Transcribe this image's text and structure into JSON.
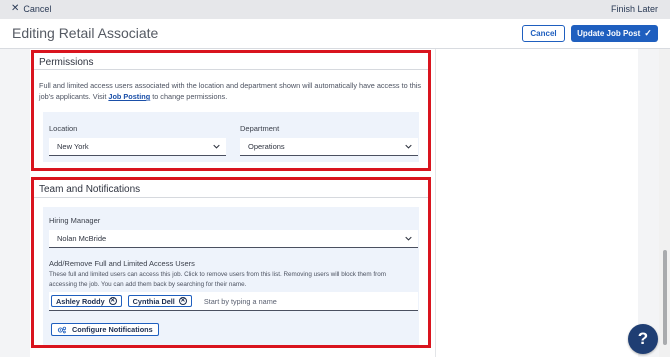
{
  "topbar": {
    "cancel_label": "Cancel",
    "finish_later_label": "Finish Later"
  },
  "header": {
    "title": "Editing Retail Associate",
    "cancel_button": "Cancel",
    "update_button": "Update Job Post"
  },
  "permissions": {
    "title": "Permissions",
    "description_pre": "Full and limited access users associated with the location and department shown will automatically have access to this job's applicants. Visit ",
    "description_link": "Job Posting",
    "description_post": " to change permissions.",
    "location_label": "Location",
    "location_value": "New York",
    "department_label": "Department",
    "department_value": "Operations"
  },
  "team": {
    "title": "Team and Notifications",
    "hiring_manager_label": "Hiring Manager",
    "hiring_manager_value": "Nolan McBride",
    "access_users_label": "Add/Remove Full and Limited Access Users",
    "access_users_help": "These full and limited users can access this job. Click to remove users from this list. Removing users will block them from accessing the job. You can add them back by searching for their name.",
    "users": [
      "Ashley Roddy",
      "Cynthia Dell"
    ],
    "users_placeholder": "Start by typing a name",
    "configure_button": "Configure Notifications"
  },
  "help": {
    "label": "?"
  },
  "colors": {
    "accent": "#1f5fbf",
    "highlight_border": "#d9141e",
    "help_bubble": "#1f3e73"
  },
  "icons": {
    "close": "close-icon",
    "check": "check-icon",
    "chevron": "chevron-down-icon",
    "remove": "remove-circle-icon",
    "settings": "settings-icon"
  }
}
